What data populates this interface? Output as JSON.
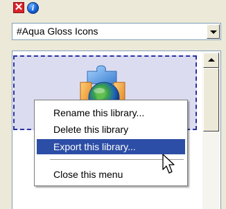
{
  "toolbar": {
    "close_glyph": "✕",
    "info_glyph": "i"
  },
  "library_select": {
    "value": "#Aqua Gloss Icons"
  },
  "context_menu": {
    "items": [
      {
        "label": "Rename this library..."
      },
      {
        "label": "Delete this library"
      },
      {
        "label": "Export this library...",
        "highlighted": true
      },
      {
        "label": "Close this menu"
      }
    ]
  },
  "colors": {
    "menu_highlight": "#2d4ea6",
    "tile_border": "#2a2fa0",
    "close_red": "#d8232a",
    "info_blue": "#1762d8"
  },
  "icons": {
    "close": "close-icon",
    "info": "info-icon",
    "tile": "globe-puzzle-icon",
    "cursor": "mouse-pointer-icon"
  }
}
